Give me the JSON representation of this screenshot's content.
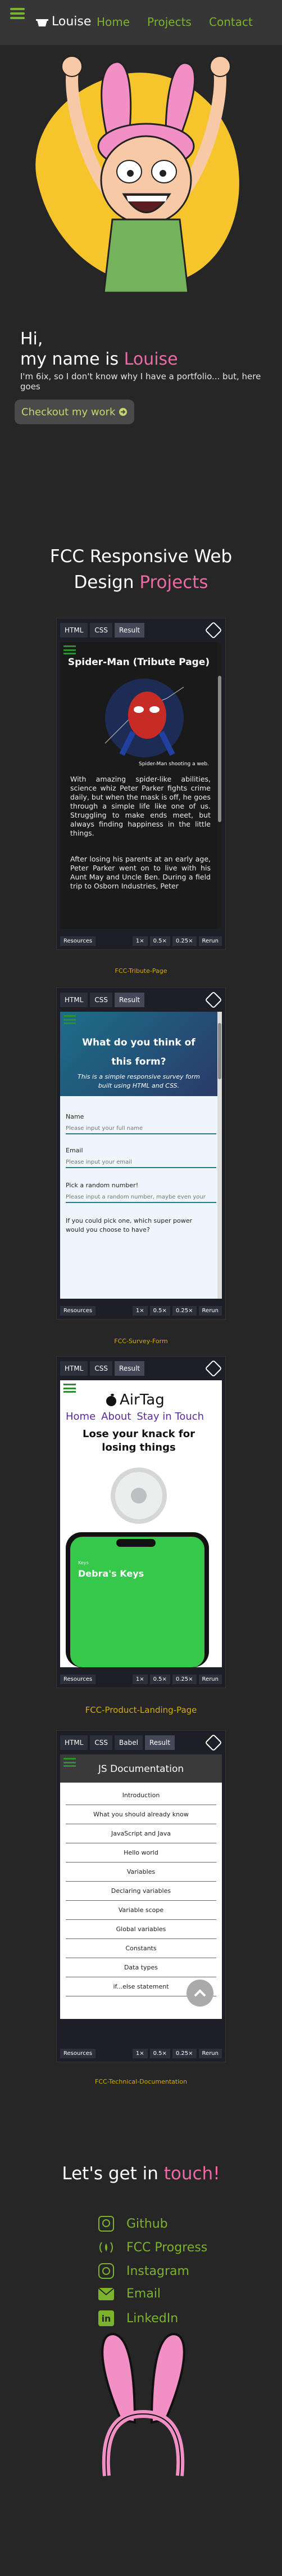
{
  "nav": {
    "brand": "Louise",
    "links": [
      "Home",
      "Projects",
      "Contact"
    ]
  },
  "hero": {
    "line1": "Hi,",
    "line2_prefix": "my name is ",
    "name": "Louise",
    "intro": "I'm 6ix, so I don't know why I have a portfolio... but, here goes",
    "cta": "Checkout my work"
  },
  "projects": {
    "heading_prefix": "FCC Responsive Web",
    "heading_mid": "Design ",
    "heading_accent": "Projects",
    "pens": [
      {
        "tabs": [
          "HTML",
          "CSS",
          "Result"
        ],
        "caption": "FCC-Tribute-Page",
        "title": "Spider-Man (Tribute Page)",
        "img_caption": "Spider-Man shooting a web.",
        "p1": "With amazing spider-like abilities, science whiz Peter Parker fights crime daily, but when the mask is off, he goes through a simple life like one of us. Struggling to make ends meet, but always finding happiness in the little things.",
        "p2": "After losing his parents at an early age, Peter Parker went on to live with his Aunt May and Uncle Ben. During a field trip to Osborn Industries, Peter"
      },
      {
        "tabs": [
          "HTML",
          "CSS",
          "Result"
        ],
        "caption": "FCC-Survey-Form",
        "title": "What do you think of this form?",
        "subtitle": "This is a simple responsive survey form built using HTML and CSS.",
        "name_label": "Name",
        "name_ph": "Please input your full name",
        "email_label": "Email",
        "email_ph": "Please input your email",
        "num_label": "Pick a random number!",
        "num_ph": "Please input a random number, maybe even your",
        "q": "If you could pick one, which super power would you choose to have?"
      },
      {
        "tabs": [
          "HTML",
          "CSS",
          "Result"
        ],
        "caption": "FCC-Product-Landing-Page",
        "brand": "AirTag",
        "links": [
          "Home",
          "About",
          "Stay in Touch"
        ],
        "tag": "Lose your knack for losing things",
        "phone_label": "Debra's Keys",
        "phone_small": "Keys"
      },
      {
        "tabs": [
          "HTML",
          "CSS",
          "Babel",
          "Result"
        ],
        "caption": "FCC-Technical-Documentation",
        "title": "JS Documentation",
        "items": [
          "Introduction",
          "What you should already know",
          "JavaScript and Java",
          "Hello world",
          "Variables",
          "Declaring variables",
          "Variable scope",
          "Global variables",
          "Constants",
          "Data types",
          "if...else statement"
        ]
      }
    ],
    "foot": {
      "resources": "Resources",
      "zooms": [
        "1×",
        "0.5×",
        "0.25×"
      ],
      "rerun": "Rerun"
    }
  },
  "contact": {
    "heading_prefix": "Let's get in ",
    "heading_accent": "touch!",
    "links": [
      "Github",
      "FCC Progress",
      "Instagram",
      "Email",
      "LinkedIn"
    ]
  },
  "colors": {
    "accent": "#ee6aa7",
    "green": "#7bb32e",
    "yellow": "#f6c52c",
    "caption": "#d6ae00"
  }
}
